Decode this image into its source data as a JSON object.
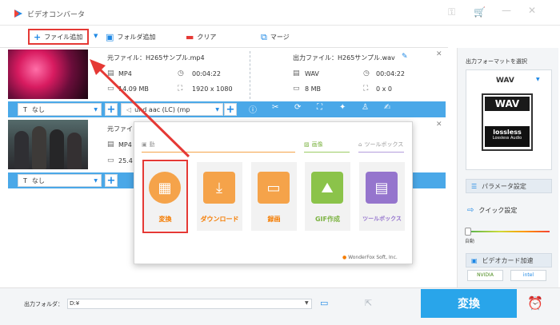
{
  "window": {
    "title": "ビデオコンバータ"
  },
  "toolbar": {
    "add_file": "ファイル追加",
    "add_folder": "フォルダ追加",
    "clear": "クリア",
    "merge": "マージ"
  },
  "files": [
    {
      "source_name": "元ファイル：H265サンプル.mp4",
      "source_format": "MP4",
      "source_duration": "00:04:22",
      "source_size": "14.09 MB",
      "source_resolution": "1920 x 1080",
      "output_name": "出力ファイル：H265サンプル.wav",
      "output_format": "WAV",
      "output_duration": "00:04:22",
      "output_size": "8 MB",
      "output_resolution": "0 x 0",
      "subtitle": "なし",
      "audio": "und aac (LC) (mp"
    },
    {
      "source_name": "元ファイ",
      "source_format": "MP4",
      "source_size": "25.4",
      "subtitle": "なし"
    }
  ],
  "popup": {
    "categories": {
      "convert": "動",
      "image": "画像",
      "toolbox": "ツールボックス"
    },
    "tiles": [
      "変換",
      "ダウンロード",
      "録画",
      "GIF作成",
      "ツールボックス"
    ],
    "brand": "WonderFox Soft, Inc."
  },
  "right_panel": {
    "select_format_label": "出力フォーマットを選択",
    "format": "WAV",
    "format_icon_text": "WAV",
    "lossless_text": "lossless",
    "lossless_sub": "Lossless Audio",
    "param_settings": "パラメータ設定",
    "quick_settings": "クイック設定",
    "slider_label": "自動",
    "gpu_accel": "ビデオカード加速",
    "gpu_nvidia": "NVIDIA",
    "gpu_intel": "intel"
  },
  "bottom": {
    "output_folder_label": "出力フォルダ：",
    "output_path": "D:¥",
    "convert_label": "変換"
  },
  "colors": {
    "accent": "#29a5ea",
    "highlight": "#e53935",
    "tile_orange": "#f57c00"
  }
}
